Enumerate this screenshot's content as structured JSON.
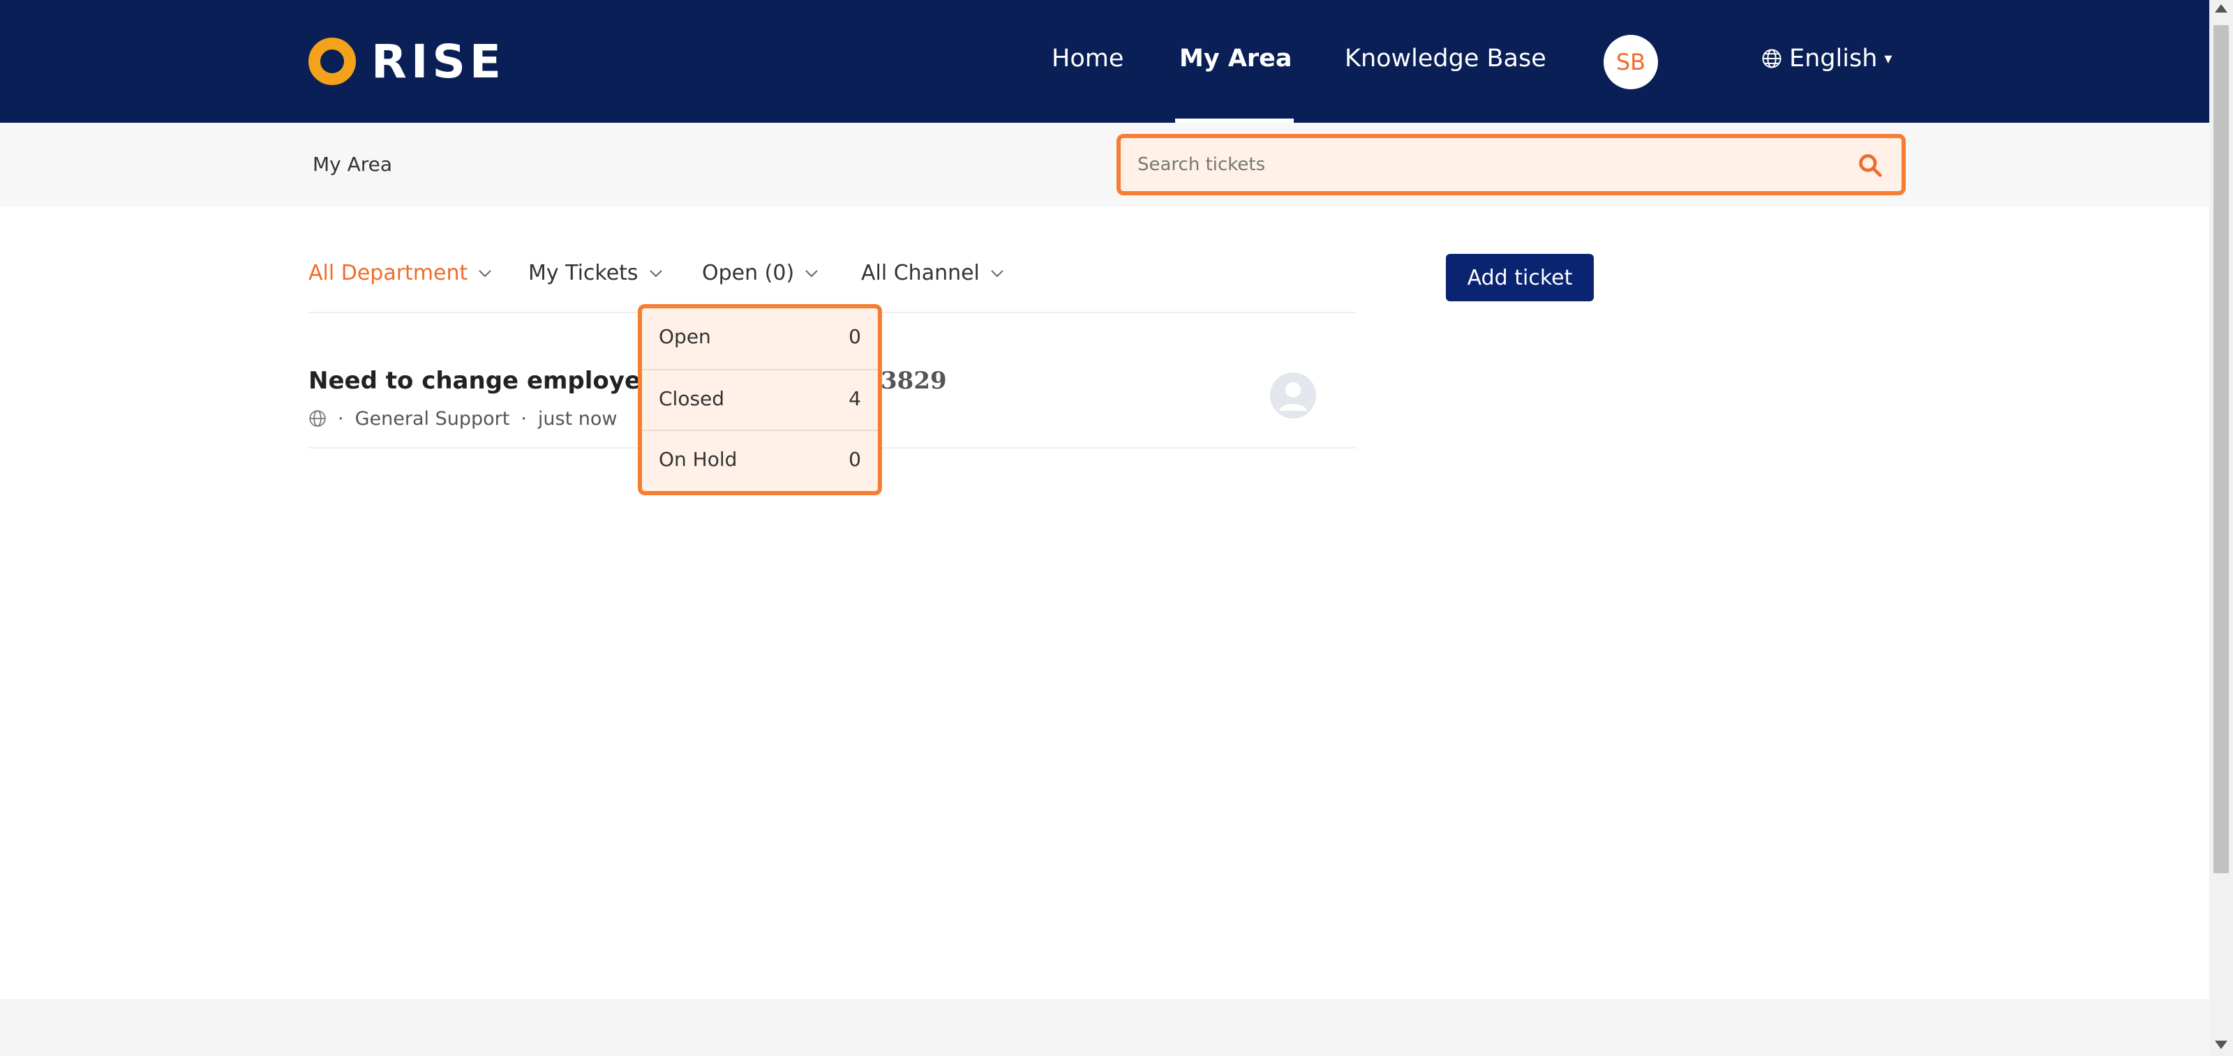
{
  "brand": {
    "name": "RISE",
    "ring_color": "#f4a21b"
  },
  "colors": {
    "nav_bg": "#091f55",
    "accent": "#f06c2c",
    "button_bg": "#0a2472",
    "highlight_border": "#f57e33"
  },
  "nav": {
    "home": "Home",
    "my_area": "My Area",
    "knowledge_base": "Knowledge Base",
    "avatar_initials": "SB",
    "language": "English"
  },
  "breadcrumb": "My Area",
  "search": {
    "placeholder": "Search tickets",
    "value": "",
    "icon": "search-icon"
  },
  "filters": {
    "department": "All Department",
    "tickets": "My Tickets",
    "status": "Open (0)",
    "channel": "All Channel"
  },
  "add_ticket_label": "Add ticket",
  "ticket": {
    "title_visible": "Need to change employee",
    "title_tail": "3829",
    "department": "General Support",
    "time": "just now",
    "channel_icon": "globe-icon",
    "avatar_icon": "user-avatar-icon"
  },
  "status_dropdown": [
    {
      "label": "Open",
      "count": "0"
    },
    {
      "label": "Closed",
      "count": "4"
    },
    {
      "label": "On Hold",
      "count": "0"
    }
  ],
  "meta_separator": "·"
}
